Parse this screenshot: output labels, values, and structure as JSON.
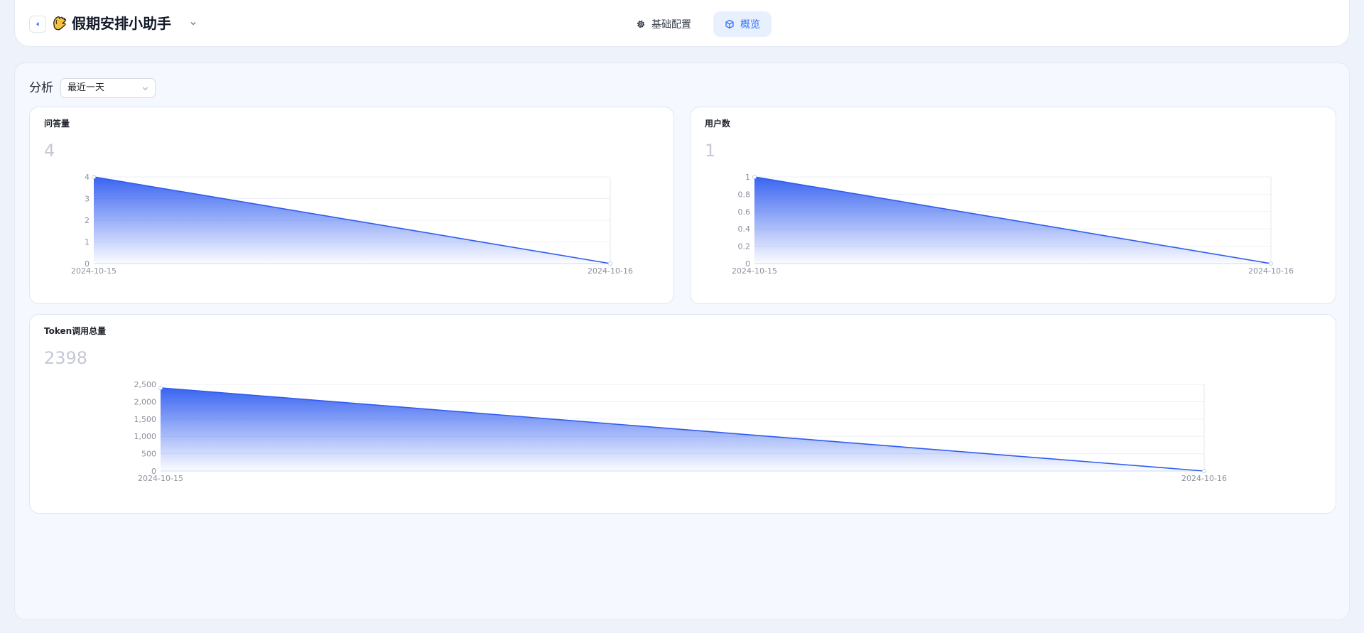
{
  "header": {
    "title": "假期安排小助手",
    "tabs": [
      {
        "label": "基础配置",
        "active": false
      },
      {
        "label": "概览",
        "active": true
      }
    ]
  },
  "overview": {
    "section_title": "分析",
    "range_select": {
      "value": "最近一天"
    }
  },
  "colors": {
    "accent": "#3370ff",
    "line": "#2f5cf0",
    "value_text": "#c4c9d3"
  },
  "chart_data": [
    {
      "type": "area",
      "title": "问答量",
      "total": "4",
      "x": [
        "2024-10-15",
        "2024-10-16"
      ],
      "series": [
        {
          "values": [
            4,
            0
          ]
        }
      ],
      "ylim": [
        0,
        4
      ],
      "yticks": [
        0,
        1,
        2,
        3,
        4
      ],
      "ytick_labels": [
        "0",
        "1",
        "2",
        "3",
        "4"
      ],
      "grid": true
    },
    {
      "type": "area",
      "title": "用户数",
      "total": "1",
      "x": [
        "2024-10-15",
        "2024-10-16"
      ],
      "series": [
        {
          "values": [
            1,
            0
          ]
        }
      ],
      "ylim": [
        0,
        1
      ],
      "yticks": [
        0,
        0.2,
        0.4,
        0.6,
        0.8,
        1
      ],
      "ytick_labels": [
        "0",
        "0.2",
        "0.4",
        "0.6",
        "0.8",
        "1"
      ],
      "grid": true
    },
    {
      "type": "area",
      "title": "Token调用总量",
      "total": "2398",
      "x": [
        "2024-10-15",
        "2024-10-16"
      ],
      "series": [
        {
          "values": [
            2398,
            0
          ]
        }
      ],
      "ylim": [
        0,
        2500
      ],
      "yticks": [
        0,
        500,
        1000,
        1500,
        2000,
        2500
      ],
      "ytick_labels": [
        "0",
        "500",
        "1,000",
        "1,500",
        "2,000",
        "2,500"
      ],
      "grid": true
    }
  ]
}
